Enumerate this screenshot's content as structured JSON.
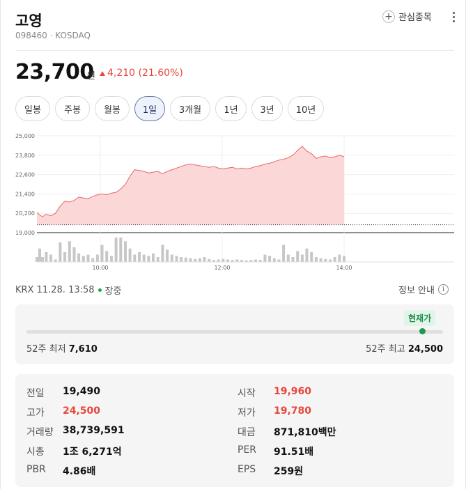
{
  "stock": {
    "name": "고영",
    "code_market": "098460 · KOSDAQ",
    "watch_label": "관심종목",
    "price": "23,700",
    "price_unit": "원",
    "change": "4,210 (21.60%)"
  },
  "periods": [
    {
      "label": "일봉",
      "active": false
    },
    {
      "label": "주봉",
      "active": false
    },
    {
      "label": "월봉",
      "active": false
    },
    {
      "label": "1일",
      "active": true
    },
    {
      "label": "3개월",
      "active": false
    },
    {
      "label": "1년",
      "active": false
    },
    {
      "label": "3년",
      "active": false
    },
    {
      "label": "10년",
      "active": false
    }
  ],
  "chart_data": {
    "type": "area",
    "y_ticks": [
      "25,000",
      "23,800",
      "22,600",
      "21,400",
      "20,200",
      "19,000"
    ],
    "ylim": [
      19000,
      25000
    ],
    "x_ticks": [
      "10:00",
      "12:00",
      "14:00"
    ],
    "prev_close": 19490,
    "x": [
      0,
      3,
      6,
      10,
      15,
      20,
      25,
      30,
      35,
      40,
      45,
      50,
      55,
      60,
      65,
      70,
      75,
      80,
      85,
      90,
      95,
      100,
      105,
      110,
      115,
      120,
      125,
      130,
      135,
      140,
      145,
      150,
      155,
      160,
      165,
      170,
      175,
      180,
      185,
      190,
      195,
      200,
      205,
      210,
      215,
      220,
      225,
      230,
      235,
      240,
      245,
      250,
      255,
      260,
      265,
      270,
      275,
      280,
      285,
      290,
      295,
      300,
      305,
      310,
      315,
      320,
      325,
      330
    ],
    "price": [
      20250,
      20100,
      19990,
      20150,
      20050,
      20200,
      20650,
      20950,
      20900,
      21000,
      21200,
      21150,
      21100,
      21250,
      21350,
      21400,
      21350,
      21450,
      21500,
      21700,
      22000,
      22500,
      22900,
      22850,
      22800,
      22700,
      22750,
      22800,
      22650,
      22800,
      22900,
      23000,
      23100,
      23200,
      23250,
      23200,
      23150,
      23100,
      23050,
      23100,
      23000,
      22950,
      23000,
      23050,
      22950,
      23000,
      22950,
      23000,
      23100,
      23150,
      23250,
      23300,
      23400,
      23500,
      23550,
      23650,
      23800,
      24100,
      24350,
      24050,
      23900,
      23600,
      23700,
      23750,
      23650,
      23700,
      23800,
      23700
    ],
    "volume": [
      20,
      55,
      20,
      40,
      30,
      10,
      80,
      40,
      85,
      60,
      35,
      25,
      30,
      15,
      30,
      70,
      45,
      25,
      100,
      100,
      85,
      55,
      30,
      40,
      30,
      25,
      35,
      20,
      70,
      50,
      30,
      25,
      20,
      18,
      15,
      12,
      15,
      20,
      12,
      8,
      10,
      12,
      10,
      8,
      10,
      8,
      6,
      8,
      10,
      8,
      30,
      25,
      15,
      10,
      70,
      30,
      20,
      45,
      30,
      55,
      40,
      20,
      15,
      12,
      10,
      20,
      30,
      25
    ]
  },
  "market": {
    "info": "KRX 11.28. 13:58",
    "status": "장중",
    "info_link": "정보 안내"
  },
  "range": {
    "badge": "현재가",
    "low_label": "52주 최저",
    "low_value": "7,610",
    "high_label": "52주 최고",
    "high_value": "24,500",
    "position": 0.95
  },
  "stats": [
    {
      "label": "전일",
      "value": "19,490",
      "red": false
    },
    {
      "label": "시작",
      "value": "19,960",
      "red": true
    },
    {
      "label": "고가",
      "value": "24,500",
      "red": true
    },
    {
      "label": "저가",
      "value": "19,780",
      "red": true
    },
    {
      "label": "거래량",
      "value": "38,739,591",
      "red": false
    },
    {
      "label": "대금",
      "value": "871,810백만",
      "red": false
    },
    {
      "label": "시총",
      "value": "1조 6,271억",
      "red": false
    },
    {
      "label": "PER",
      "value": "91.51배",
      "red": false
    },
    {
      "label": "PBR",
      "value": "4.86배",
      "red": false
    },
    {
      "label": "EPS",
      "value": "259원",
      "red": false
    }
  ],
  "colors": {
    "up": "#e8463b",
    "area_fill": "#fbd7d7",
    "area_line": "#e66a6a",
    "volume_bar": "#c7c7c7",
    "status_green": "#23a35a"
  }
}
